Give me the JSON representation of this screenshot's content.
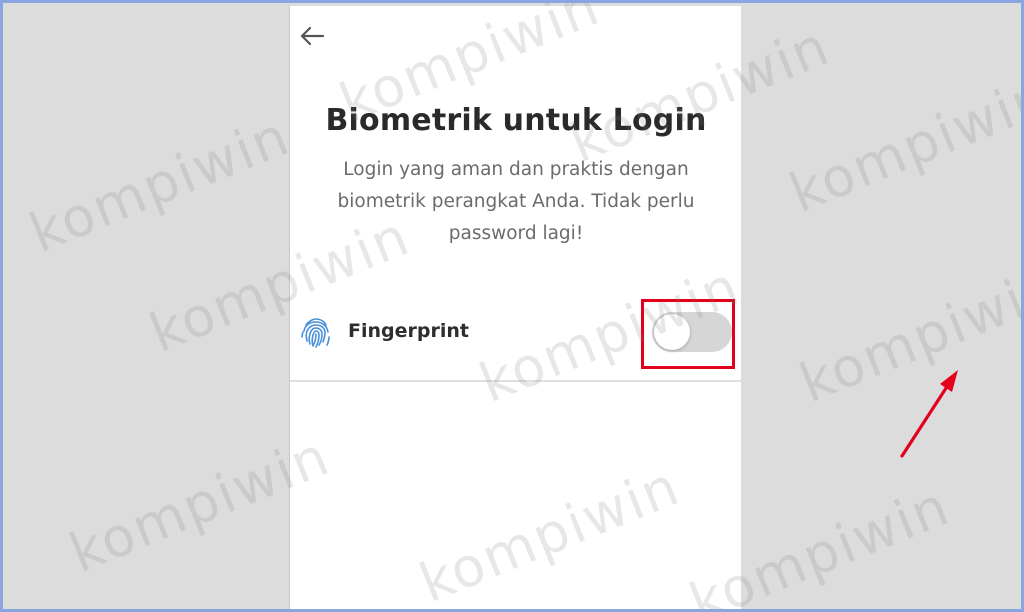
{
  "screen": {
    "title": "Biometrik untuk Login",
    "description_lines": [
      "Login yang aman dan praktis dengan",
      "biometrik perangkat Anda. Tidak perlu",
      "password lagi!"
    ]
  },
  "nav": {
    "back_icon": "arrow-left-icon"
  },
  "settings": {
    "fingerprint": {
      "label": "Fingerprint",
      "icon": "fingerprint-icon",
      "enabled": false
    }
  },
  "annotation": {
    "highlight_color": "#e3001b"
  },
  "watermark": {
    "text": "kompiwin"
  },
  "colors": {
    "frame_border": "#8aa6e0",
    "side_bg": "#dcdcdc",
    "toggle_off": "#d6d6d6",
    "fingerprint_icon": "#4a90d9"
  }
}
